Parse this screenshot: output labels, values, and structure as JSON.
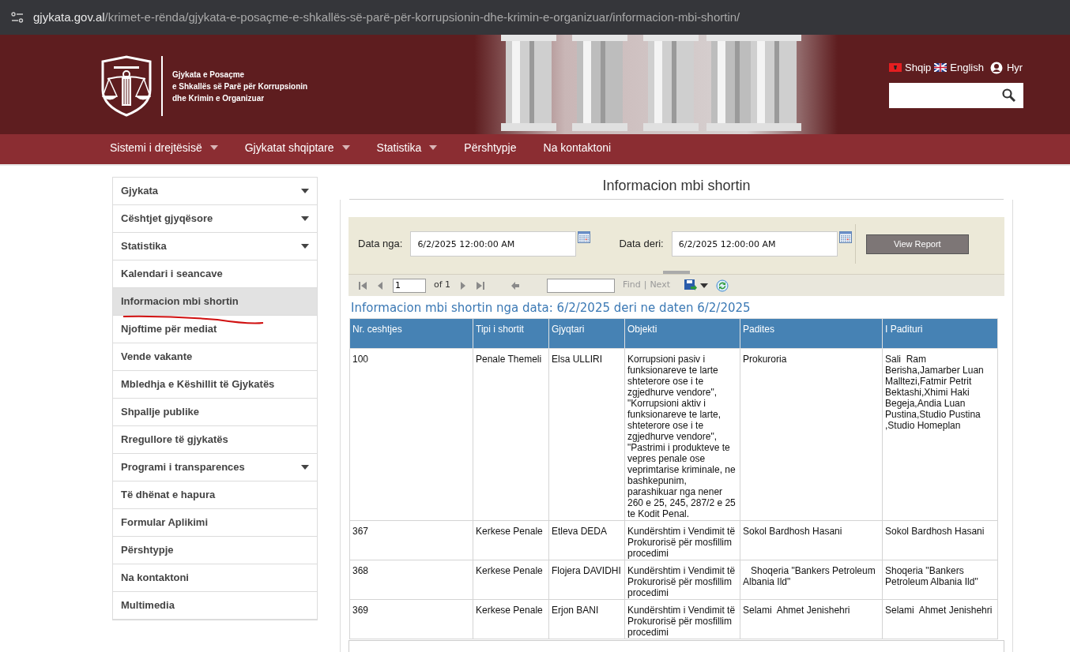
{
  "address_bar": {
    "host": "gjykata.gov.al",
    "path": "/krimet-e-rënda/gjykata-e-posaçme-e-shkallës-së-parë-për-korrupsionin-dhe-krimin-e-organizuar/informacion-mbi-shortin/"
  },
  "header": {
    "logo_lines": [
      "Gjykata e Posaçme",
      "e Shkallës së Parë për Korrupsionin",
      "dhe Krimin e Organizuar"
    ],
    "languages": [
      {
        "label": "Shqip",
        "kind": "albania"
      },
      {
        "label": "English",
        "kind": "uk"
      }
    ],
    "login": "Hyr"
  },
  "nav": [
    {
      "label": "Sistemi i drejtësisë",
      "dropdown": true
    },
    {
      "label": "Gjykatat shqiptare",
      "dropdown": true
    },
    {
      "label": "Statistika",
      "dropdown": true
    },
    {
      "label": "Përshtypje",
      "dropdown": false
    },
    {
      "label": "Na kontaktoni",
      "dropdown": false
    }
  ],
  "sidebar": [
    {
      "label": "Gjykata",
      "expandable": true,
      "selected": false
    },
    {
      "label": "Cështjet gjyqësore",
      "expandable": true,
      "selected": false
    },
    {
      "label": "Statistika",
      "expandable": true,
      "selected": false
    },
    {
      "label": "Kalendari i seancave",
      "expandable": false,
      "selected": false
    },
    {
      "label": "Informacion mbi shortin",
      "expandable": false,
      "selected": true
    },
    {
      "label": "Njoftime për mediat",
      "expandable": false,
      "selected": false
    },
    {
      "label": "Vende vakante",
      "expandable": false,
      "selected": false
    },
    {
      "label": "Mbledhja e Këshillit të Gjykatës",
      "expandable": false,
      "selected": false
    },
    {
      "label": "Shpallje publike",
      "expandable": false,
      "selected": false
    },
    {
      "label": "Rregullore të gjykatës",
      "expandable": false,
      "selected": false
    },
    {
      "label": "Programi i transparences",
      "expandable": true,
      "selected": false
    },
    {
      "label": "Të dhënat e hapura",
      "expandable": false,
      "selected": false
    },
    {
      "label": "Formular Aplikimi",
      "expandable": false,
      "selected": false
    },
    {
      "label": "Përshtypje",
      "expandable": false,
      "selected": false
    },
    {
      "label": "Na kontaktoni",
      "expandable": false,
      "selected": false
    },
    {
      "label": "Multimedia",
      "expandable": false,
      "selected": false
    }
  ],
  "page_title": "Informacion mbi shortin",
  "report": {
    "params": [
      {
        "label": "Data nga:",
        "value": "6/2/2025 12:00:00 AM"
      },
      {
        "label": "Data deri:",
        "value": "6/2/2025 12:00:00 AM"
      }
    ],
    "view_button": "View Report",
    "toolbar": {
      "page": "1",
      "of": "of 1",
      "find": "Find",
      "separator": "|",
      "next": "Next"
    },
    "heading": "Informacion mbi shortin nga data: 6/2/2025 deri ne daten 6/2/2025",
    "columns": [
      "Nr. ceshtjes",
      "Tipi i shortit",
      "Gjyqtari",
      "Objekti",
      "Padites",
      "I Padituri"
    ],
    "rows": [
      [
        "100",
        "Penale Themeli",
        "Elsa ULLIRI",
        "Korrupsioni pasiv i funksionareve te larte shteterore ose i te zgjedhurve vendore\", \"Korrupsioni aktiv i funksionareve te larte, shteterore ose i te zgjedhurve vendore\", \"Pastrimi i produkteve te vepres penale ose veprimtarise kriminale, ne bashkepunim, parashikuar nga nener 260 e 25, 245, 287/2 e 25 te Kodit Penal.",
        "Prokuroria",
        "Sali  Ram Berisha,Jamarber Luan Malltezi,Fatmir Petrit Bektashi,Xhimi Haki Begeja,Andia Luan Pustina,Studio Pustina ,Studio Homeplan"
      ],
      [
        "367",
        "Kerkese Penale",
        "Etleva DEDA",
        "Kundërshtim i Vendimit të Prokurorisë për mosfillim procedimi",
        "Sokol Bardhosh Hasani",
        "Sokol Bardhosh Hasani"
      ],
      [
        "368",
        "Kerkese Penale",
        "Flojera DAVIDHI",
        "Kundërshtim i Vendimit të Prokurorisë për mosfillim procedimi",
        "   Shoqeria \"Bankers Petroleum Albania Ild\"",
        "Shoqeria \"Bankers Petroleum Albania Ild\""
      ],
      [
        "369",
        "Kerkese Penale",
        "Erjon BANI",
        "Kundërshtim i Vendimit të Prokurorisë për mosfillim procedimi",
        "Selami  Ahmet Jenishehri",
        "Selami  Ahmet Jenishehri"
      ]
    ]
  }
}
